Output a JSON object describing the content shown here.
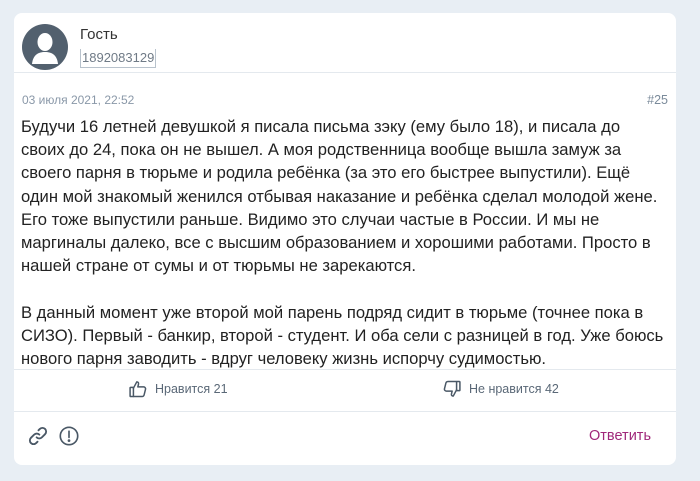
{
  "author": {
    "name": "Гость",
    "id": "1892083129"
  },
  "comment": {
    "date": "03 июля 2021, 22:52",
    "number": "#25",
    "paragraphs": [
      "Будучи 16 летней девушкой я писала письма зэку (ему было 18), и писала до своих до 24, пока он не вышел. А моя родственница вообще вышла замуж за своего парня в тюрьме и родила ребёнка (за это его быстрее выпустили). Ещё один мой знакомый женился отбывая наказание и ребёнка сделал молодой жене. Его тоже выпустили раньше. Видимо это случаи частые в России. И мы не маргиналы далеко, все с высшим образованием и хорошими работами. Просто в нашей стране от сумы и от тюрьмы не зарекаются.",
      "В данный момент уже второй мой парень подряд сидит в тюрьме (точнее пока в СИЗО). Первый - банкир, второй - студент. И оба сели с разницей в год. Уже боюсь нового парня заводить - вдруг человеку жизнь испорчу судимостью."
    ]
  },
  "reactions": {
    "like_label": "Нравится 21",
    "dislike_label": "Не нравится 42"
  },
  "footer": {
    "reply_label": "Ответить"
  },
  "icons": {
    "avatar": "user-silhouette-icon",
    "like": "thumbs-up-icon",
    "dislike": "thumbs-down-icon",
    "link": "link-icon",
    "report": "exclamation-circle-icon"
  },
  "colors": {
    "accent": "#a0287a",
    "muted": "#8a98a8",
    "background": "#e8eef4"
  }
}
